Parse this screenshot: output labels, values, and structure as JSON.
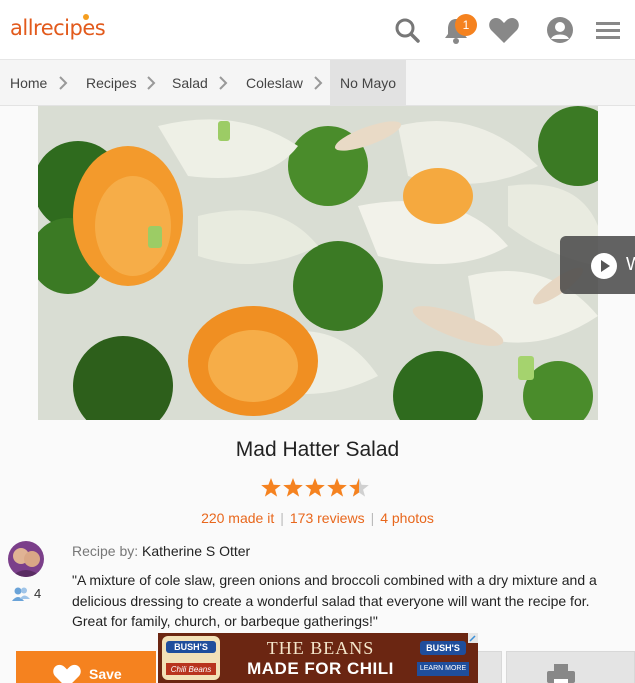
{
  "header": {
    "logo_text": "allrecipes",
    "notification_count": "1",
    "icons": [
      "search-icon",
      "bell-icon",
      "heart-icon",
      "user-icon",
      "menu-icon"
    ],
    "accent_color": "#f5821f"
  },
  "breadcrumb": [
    "Home",
    "Recipes",
    "Salad",
    "Coleslaw",
    "No Mayo"
  ],
  "recipe": {
    "title": "Mad Hatter Salad",
    "rating": 4.5,
    "made_it": "220 made it",
    "reviews": "173 reviews",
    "photos": "4 photos",
    "recipe_by_label": "Recipe by:",
    "author": "Katherine S Otter",
    "followers": "4",
    "description": "\"A mixture of cole slaw, green onions and broccoli combined with a dry mixture and a delicious dressing to create a wonderful salad that everyone will want the recipe for. Great for family, church, or barbeque gatherings!\""
  },
  "video_tab": {
    "label": "W"
  },
  "actions": {
    "save_label": "Save"
  },
  "ad": {
    "line1": "THE BEANS",
    "line2": "MADE FOR CHILI",
    "cta": "LEARN MORE",
    "brand": "BUSH'S",
    "product": "Chili Beans"
  }
}
